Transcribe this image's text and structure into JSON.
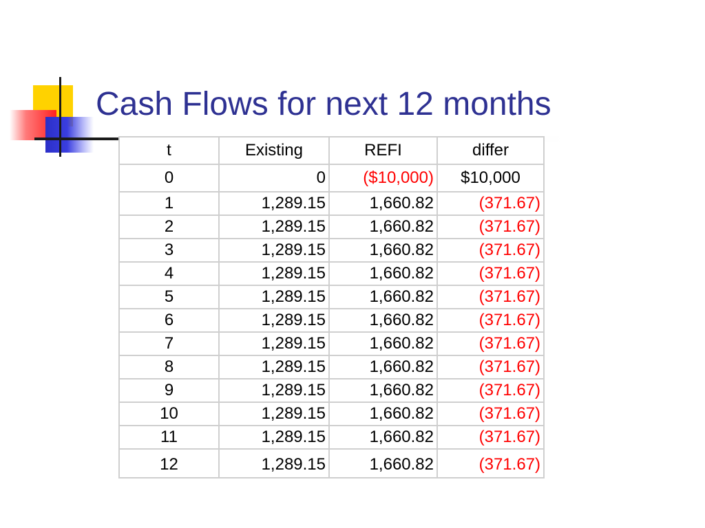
{
  "slide": {
    "title": "Cash Flows for next 12 months"
  },
  "table": {
    "headers": [
      "t",
      "Existing",
      "REFI",
      "differ"
    ],
    "rows": [
      [
        "0",
        "0",
        "($10,000)",
        "$10,000"
      ],
      [
        "1",
        "1,289.15",
        "1,660.82",
        "(371.67)"
      ],
      [
        "2",
        "1,289.15",
        "1,660.82",
        "(371.67)"
      ],
      [
        "3",
        "1,289.15",
        "1,660.82",
        "(371.67)"
      ],
      [
        "4",
        "1,289.15",
        "1,660.82",
        "(371.67)"
      ],
      [
        "5",
        "1,289.15",
        "1,660.82",
        "(371.67)"
      ],
      [
        "6",
        "1,289.15",
        "1,660.82",
        "(371.67)"
      ],
      [
        "7",
        "1,289.15",
        "1,660.82",
        "(371.67)"
      ],
      [
        "8",
        "1,289.15",
        "1,660.82",
        "(371.67)"
      ],
      [
        "9",
        "1,289.15",
        "1,660.82",
        "(371.67)"
      ],
      [
        "10",
        "1,289.15",
        "1,660.82",
        "(371.67)"
      ],
      [
        "11",
        "1,289.15",
        "1,660.82",
        "(371.67)"
      ],
      [
        "12",
        "1,289.15",
        "1,660.82",
        "(371.67)"
      ]
    ]
  },
  "colors": {
    "title": "#2e3192",
    "negative": "#ff0000",
    "text": "#000000",
    "grid": "#cfcfcf"
  }
}
